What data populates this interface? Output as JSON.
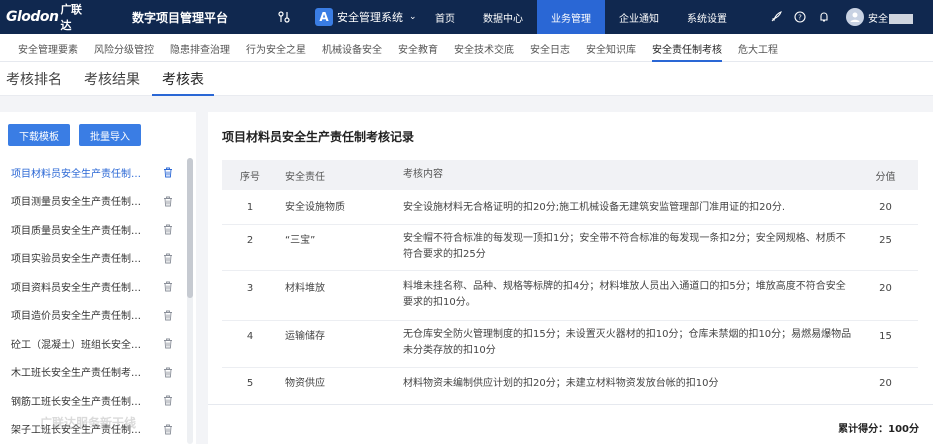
{
  "header": {
    "logo": "Glodon",
    "logo_cn": "广联达",
    "platform_name": "数字项目管理平台",
    "system_select": "安全管理系统",
    "nav": [
      "首页",
      "数据中心",
      "业务管理",
      "企业通知",
      "系统设置"
    ],
    "active_nav": "业务管理",
    "username": "安全"
  },
  "subnav": {
    "items": [
      "安全管理要素",
      "风险分级管控",
      "隐患排查治理",
      "行为安全之星",
      "机械设备安全",
      "安全教育",
      "安全技术交底",
      "安全日志",
      "安全知识库",
      "安全责任制考核",
      "危大工程"
    ],
    "active": "安全责任制考核"
  },
  "tabs": {
    "items": [
      "考核排名",
      "考核结果",
      "考核表"
    ],
    "active": "考核表"
  },
  "left": {
    "download_label": "下载模板",
    "import_label": "批量导入",
    "files": [
      "项目材料员安全生产责任制考核表",
      "项目测量员安全生产责任制考核表",
      "项目质量员安全生产责任制考核表",
      "项目实验员安全生产责任制考核表",
      "项目资料员安全生产责任制考核表",
      "项目造价员安全生产责任制考核表",
      "砼工（混凝土）班组长安全生产责任制考核表",
      "木工班长安全生产责任制考核表",
      "钢筋工班长安全生产责任制考核表",
      "架子工班长安全生产责任制考核表"
    ]
  },
  "right": {
    "title": "项目材料员安全生产责任制考核记录",
    "columns": [
      "序号",
      "安全责任",
      "考核内容",
      "分值"
    ],
    "rows": [
      {
        "no": "1",
        "duty": "安全设施物质",
        "content": "安全设施材料无合格证明的扣20分;施工机械设备无建筑安监管理部门准用证的扣20分.",
        "score": "20"
      },
      {
        "no": "2",
        "duty": "“三宝”",
        "content": "安全帽不符合标准的每发现一顶扣1分；安全带不符合标准的每发现一条扣2分；安全网规格、材质不符合要求的扣25分",
        "score": "25"
      },
      {
        "no": "3",
        "duty": "材料堆放",
        "content": "料堆未挂名称、品种、规格等标牌的扣4分；材料堆放人员出入通道口的扣5分；堆放高度不符合安全要求的扣10分。",
        "score": "20"
      },
      {
        "no": "4",
        "duty": "运输储存",
        "content": "无仓库安全防火管理制度的扣15分；未设置灭火器材的扣10分；仓库未禁烟的扣10分；易燃易爆物品未分类存放的扣10分",
        "score": "15"
      },
      {
        "no": "5",
        "duty": "物资供应",
        "content": "材料物资未编制供应计划的扣20分；未建立材料物资发放台帐的扣10分",
        "score": "20"
      }
    ],
    "total": "累计得分：100分"
  },
  "watermark": "广联达服务新干线",
  "colors": {
    "topbar": "#10284f",
    "accent": "#2a67d5",
    "button": "#3a7de4"
  }
}
